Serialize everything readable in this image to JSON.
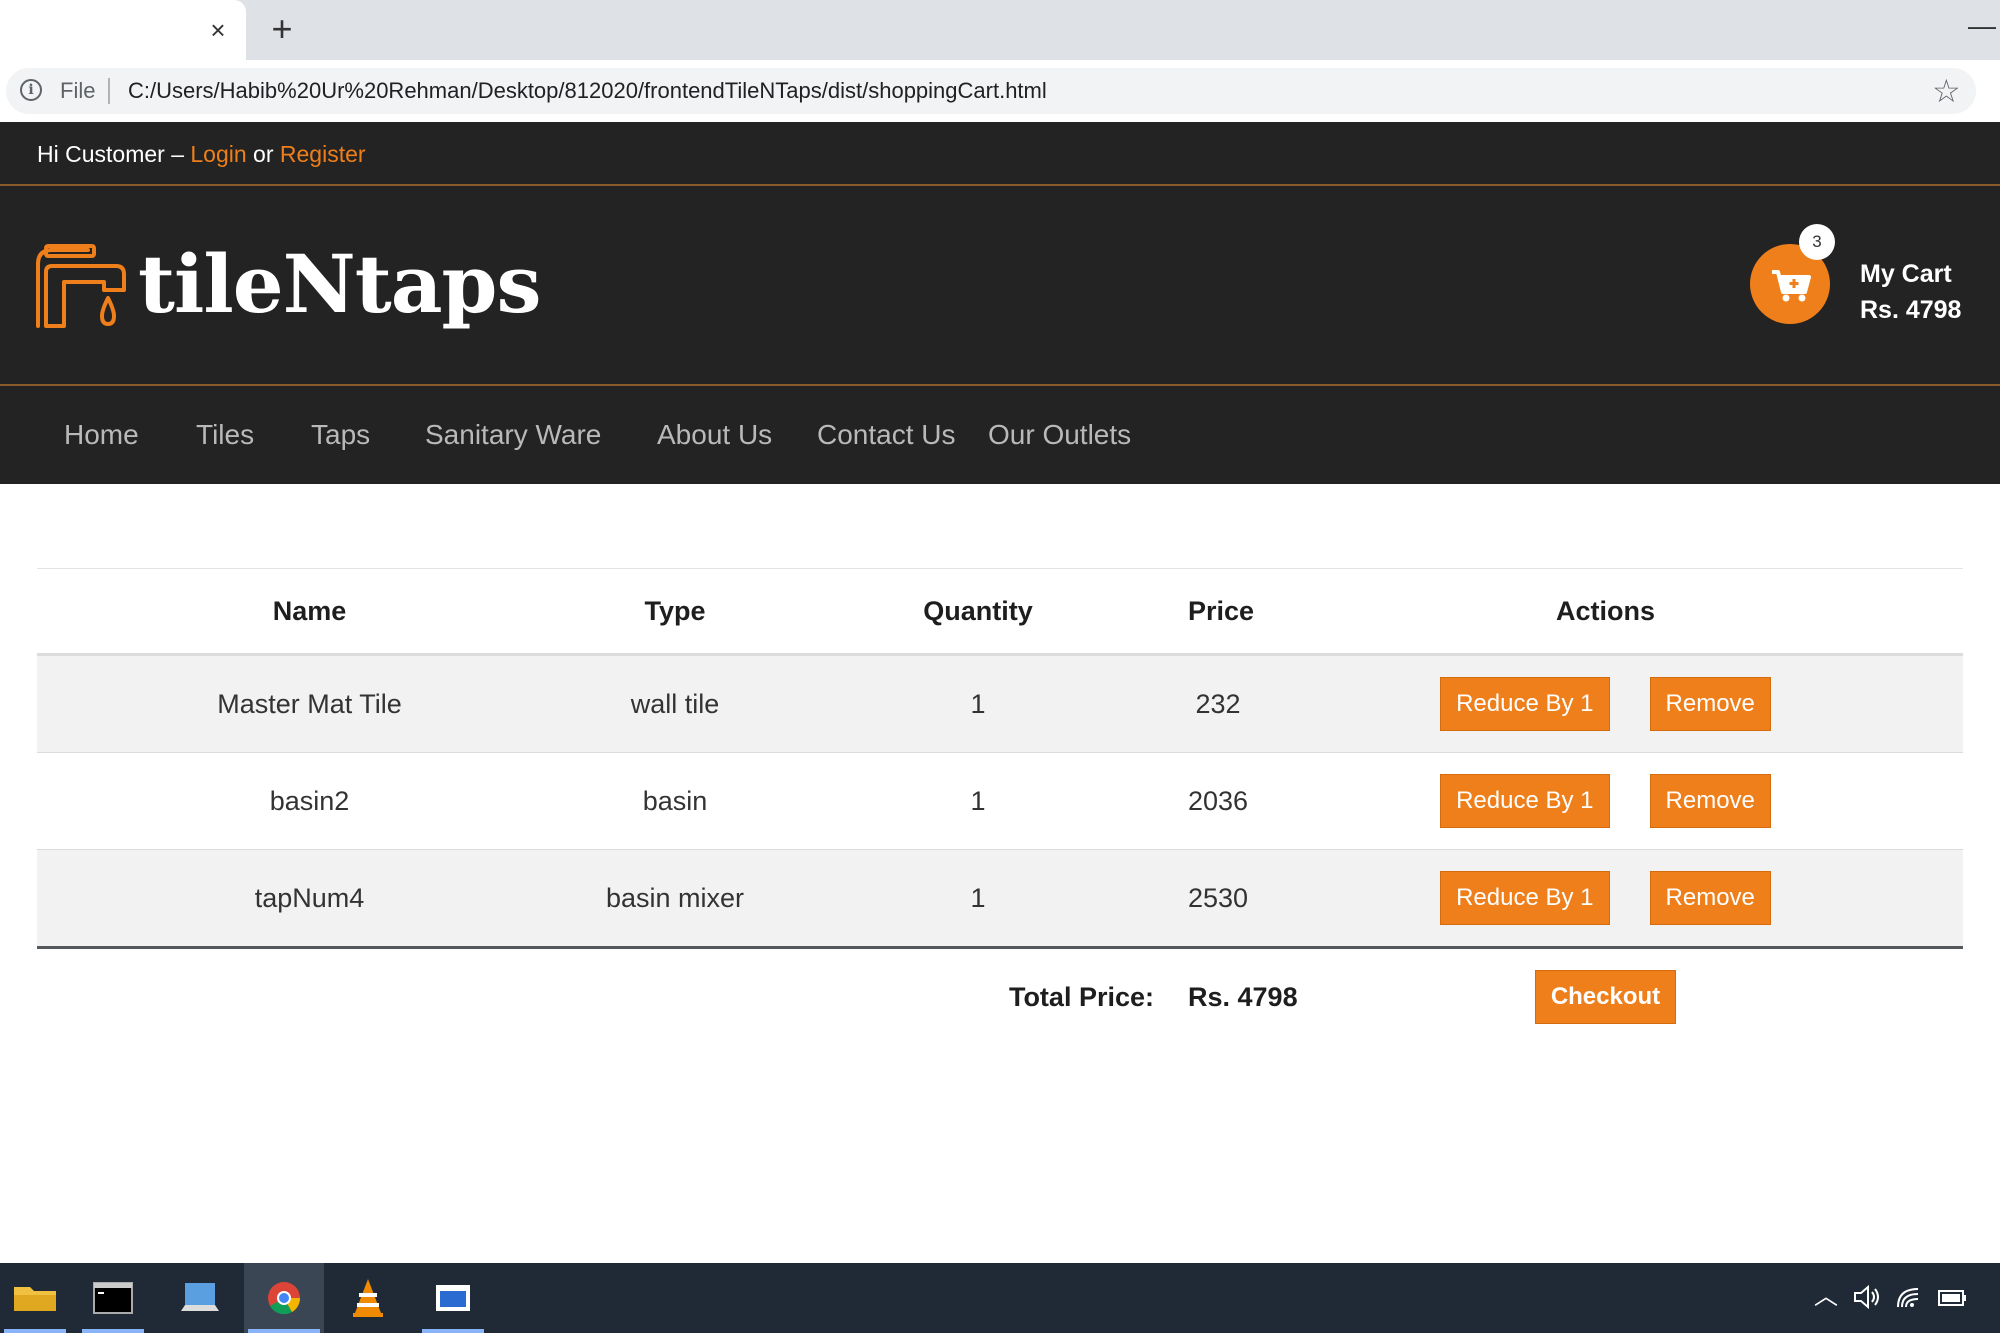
{
  "browser": {
    "tab": {
      "close_glyph": "×"
    },
    "new_tab_glyph": "+",
    "window_minimize_glyph": "—",
    "address": {
      "scheme_label": "File",
      "url": "C:/Users/Habib%20Ur%20Rehman/Desktop/812020/frontendTileNTaps/dist/shoppingCart.html",
      "info_icon": "info-icon",
      "bookmark_icon": "star-icon"
    }
  },
  "topbar": {
    "greeting": "Hi Customer –",
    "login_label": "Login",
    "or_label": "or",
    "register_label": "Register"
  },
  "header": {
    "logo_icon": "faucet-icon",
    "logo_text": "tileNtaps",
    "cart": {
      "icon": "cart-icon",
      "count": "3",
      "label": "My Cart",
      "total": "Rs. 4798"
    }
  },
  "nav": {
    "items": [
      "Home",
      "Tiles",
      "Taps",
      "Sanitary Ware",
      "About Us",
      "Contact Us",
      "Our Outlets"
    ]
  },
  "cart_table": {
    "headers": [
      "Name",
      "Type",
      "Quantity",
      "Price",
      "Actions"
    ],
    "rows": [
      {
        "name": "Master Mat Tile",
        "type": "wall tile",
        "quantity": "1",
        "price": "232"
      },
      {
        "name": "basin2",
        "type": "basin",
        "quantity": "1",
        "price": "2036"
      },
      {
        "name": "tapNum4",
        "type": "basin mixer",
        "quantity": "1",
        "price": "2530"
      }
    ],
    "reduce_label": "Reduce By 1",
    "remove_label": "Remove",
    "total_label": "Total Price:",
    "total_value": "Rs. 4798",
    "checkout_label": "Checkout"
  },
  "taskbar": {
    "apps": [
      "file-explorer-icon",
      "command-prompt-icon",
      "remote-desktop-icon",
      "chrome-icon",
      "vlc-icon",
      "window-app-icon"
    ],
    "tray_icons": [
      "chevron-up-icon",
      "speaker-icon",
      "wifi-icon",
      "battery-icon"
    ]
  },
  "colors": {
    "accent": "#ef7f1a",
    "header_bg": "#232323",
    "taskbar_bg": "#1f2a36"
  }
}
